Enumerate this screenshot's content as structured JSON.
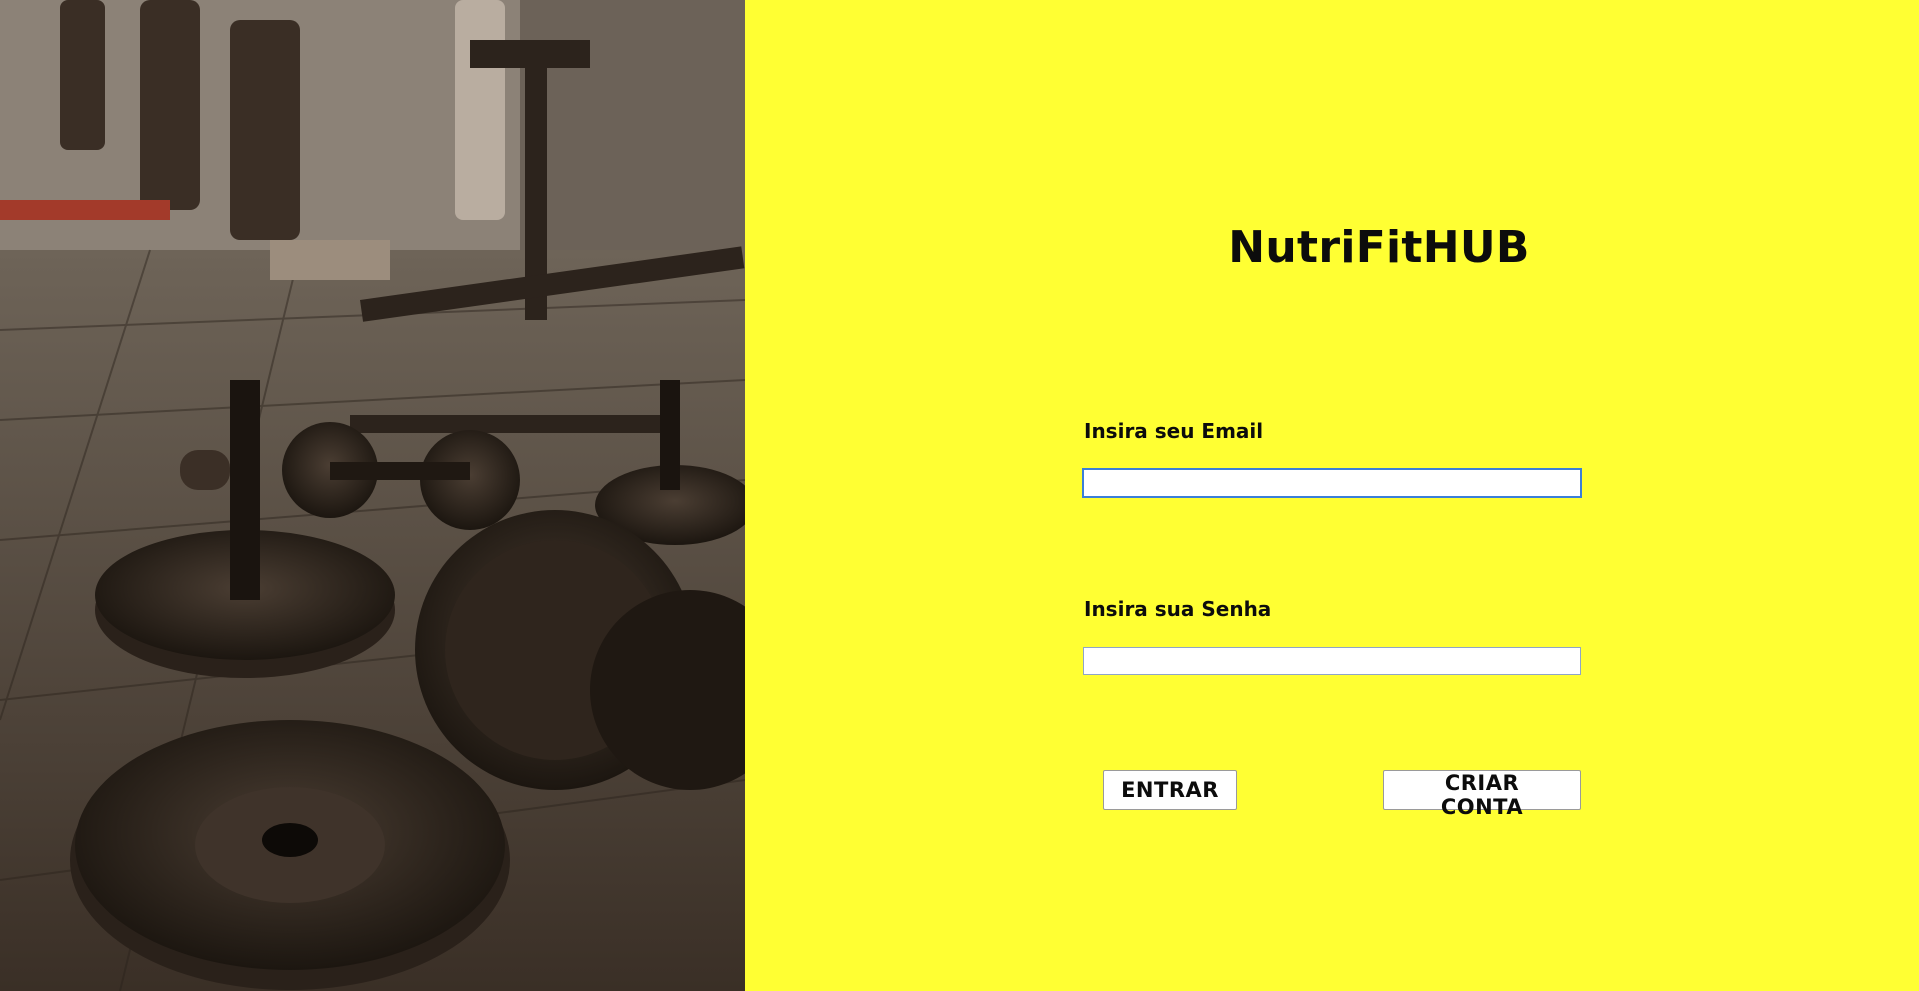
{
  "background": {
    "image_description_icon": "gym-weights-photo",
    "page_color": "#ffff33"
  },
  "form": {
    "title": "NutriFitHUB",
    "email_label": "Insira seu Email",
    "email_value": "",
    "password_label": "Insira sua Senha",
    "password_value": "",
    "login_button": "ENTRAR",
    "signup_button": "CRIAR CONTA"
  }
}
